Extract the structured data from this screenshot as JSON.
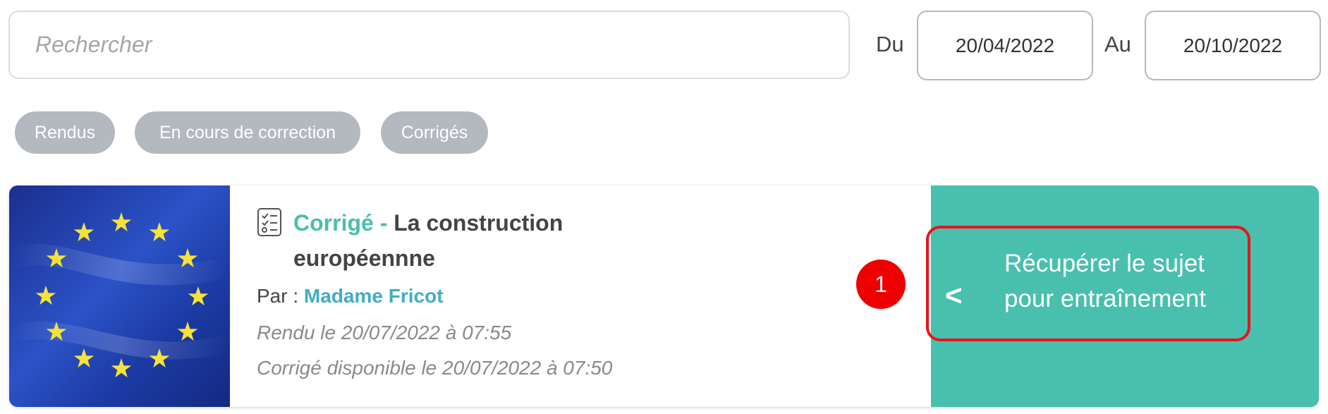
{
  "search": {
    "placeholder": "Rechercher"
  },
  "date_range": {
    "from_label": "Du",
    "from_value": "20/04/2022",
    "to_label": "Au",
    "to_value": "20/10/2022"
  },
  "filters": [
    {
      "label": "Rendus"
    },
    {
      "label": "En cours de correction"
    },
    {
      "label": "Corrigés"
    }
  ],
  "card": {
    "status": "Corrigé -",
    "title": "La construction européennne",
    "par_label": "Par :",
    "author": "Madame Fricot",
    "submitted": "Rendu le 20/07/2022 à 07:55",
    "corrected": "Corrigé disponible le 20/07/2022 à 07:50",
    "action_label": "Récupérer le sujet pour entraînement",
    "action_chevron": "<",
    "icon": "checklist-icon"
  },
  "annotation": {
    "number": "1",
    "color": "#ee0000"
  },
  "colors": {
    "accent": "#49bfae",
    "author_link": "#41acc8",
    "pill": "#b4b8bf",
    "highlight": "#e8131a",
    "flag_blue": "#1f3fa8",
    "flag_stars": "#f5e23a"
  }
}
